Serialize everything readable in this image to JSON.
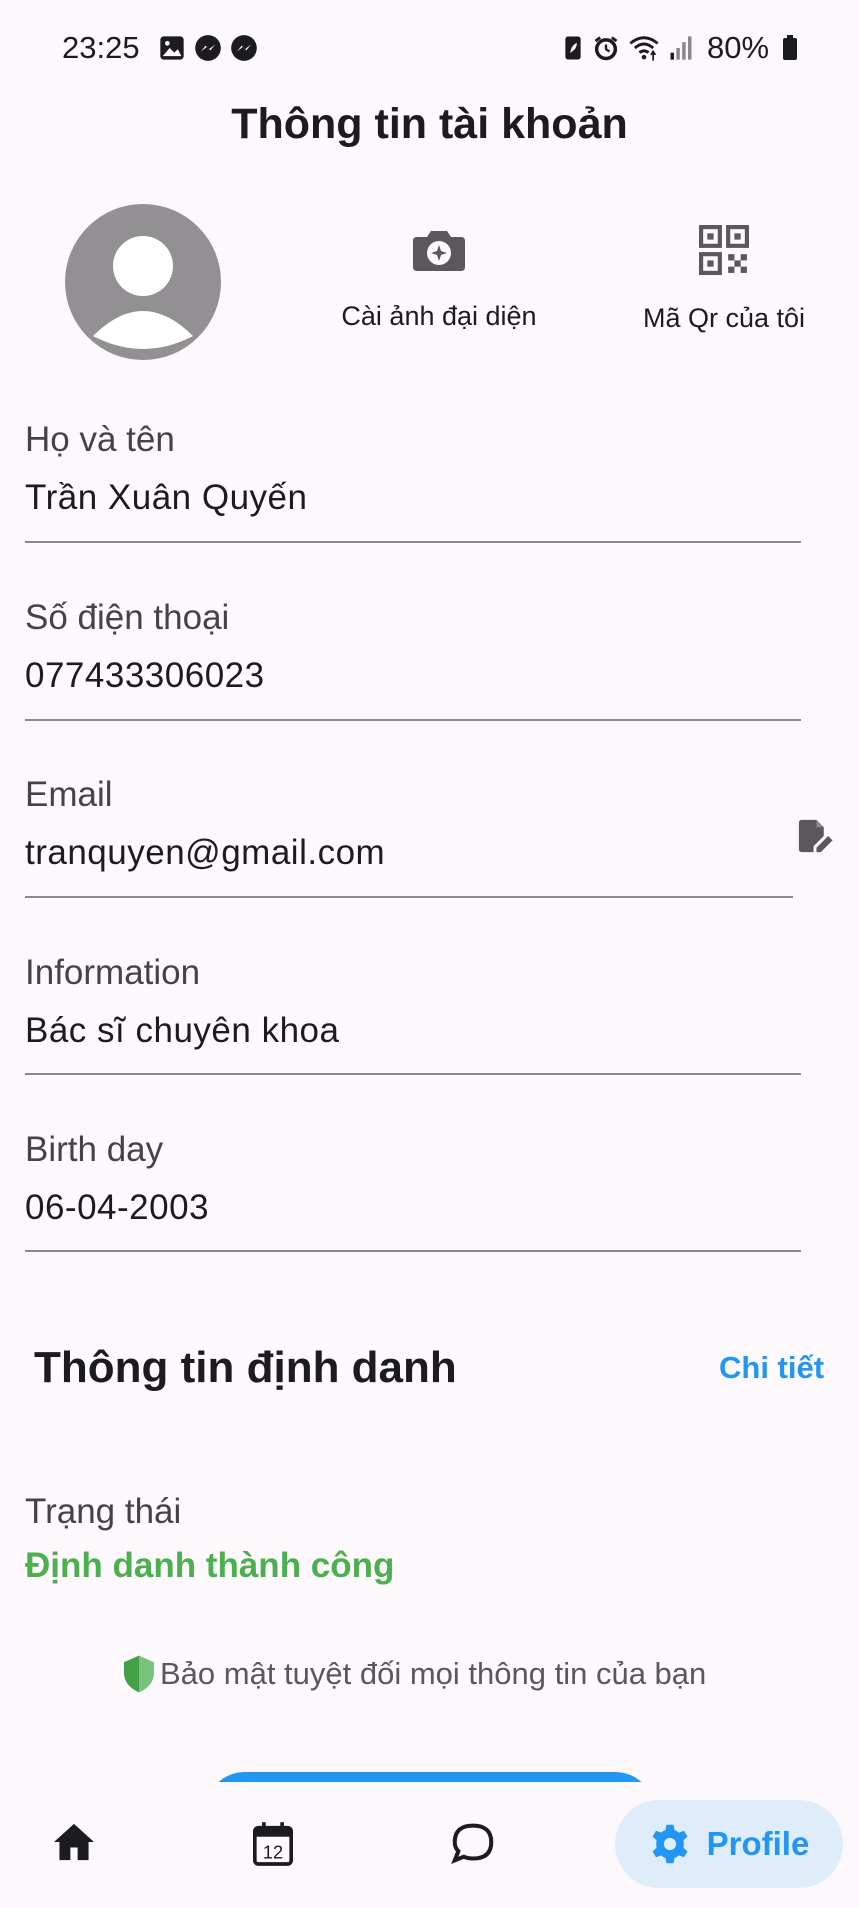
{
  "status_bar": {
    "time": "23:25",
    "battery_percent": "80%",
    "left_icons": [
      "gallery-icon",
      "messenger-icon",
      "messenger-icon"
    ],
    "right_icons": [
      "battery-saver-icon",
      "alarm-icon",
      "wifi-icon",
      "signal-icon",
      "battery-icon"
    ]
  },
  "header": {
    "title": "Thông tin tài khoản"
  },
  "profile_actions": {
    "set_avatar_label": "Cài ảnh đại diện",
    "my_qr_label": "Mã Qr của tôi"
  },
  "fields": {
    "full_name": {
      "label": "Họ và tên",
      "value": "Trần Xuân Quyến"
    },
    "phone": {
      "label": "Số điện thoại",
      "value": "077433306023"
    },
    "email": {
      "label": "Email",
      "value": "tranquyen@gmail.com"
    },
    "information": {
      "label": "Information",
      "value": "Bác sĩ chuyên khoa"
    },
    "birthday": {
      "label": "Birth day",
      "value": "06-04-2003"
    }
  },
  "identity": {
    "title": "Thông tin định danh",
    "detail_link": "Chi tiết",
    "status_label": "Trạng thái",
    "status_value": "Định danh thành công",
    "security_note": "Bảo mật tuyệt đối mọi thông tin của bạn"
  },
  "bottom_nav": {
    "items": [
      "home-icon",
      "calendar-icon",
      "chat-icon",
      "settings-icon"
    ],
    "calendar_day": "12",
    "active_label": "Profile"
  },
  "colors": {
    "accent": "#2196f3",
    "success": "#4caf50",
    "background": "#fcf8fc",
    "avatar_gray": "#929092"
  }
}
